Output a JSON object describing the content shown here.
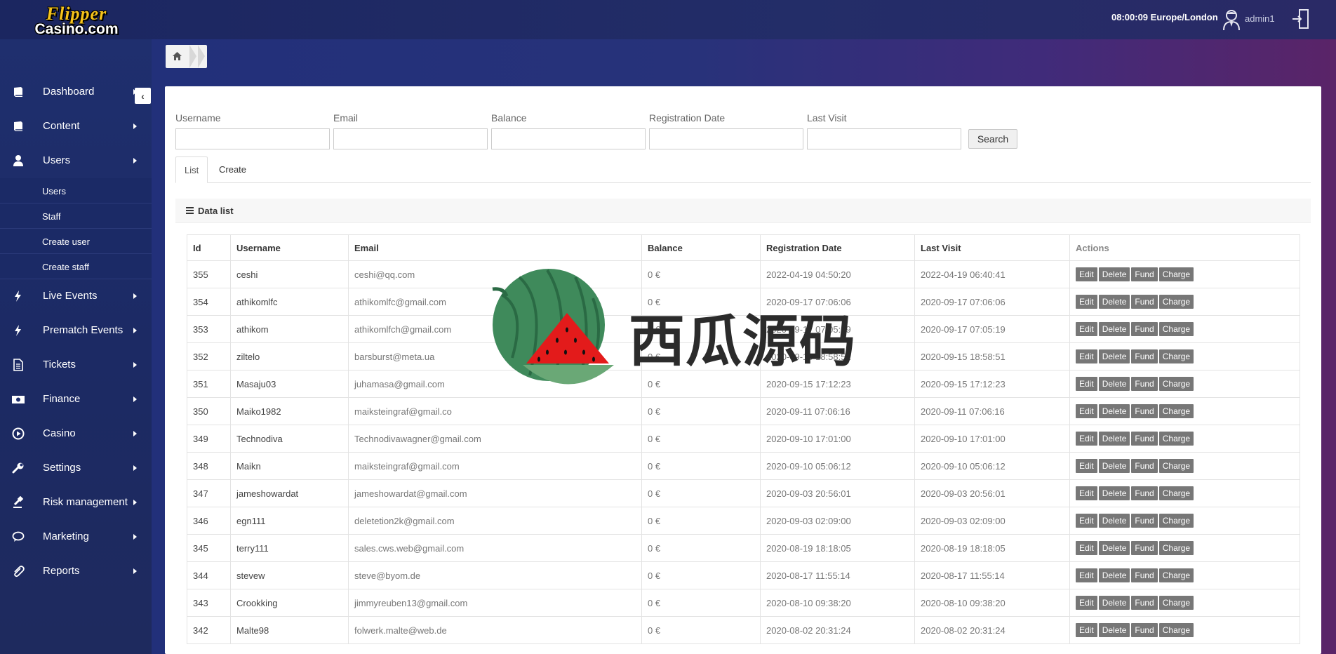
{
  "app": {
    "logo_line1": "Flipper",
    "logo_line2": "Casino.com"
  },
  "header": {
    "clock": "08:00:09 Europe/London",
    "username": "admin1"
  },
  "sidebar": {
    "items": [
      {
        "label": "Dashboard",
        "icon": "book-icon"
      },
      {
        "label": "Content",
        "icon": "book-icon"
      },
      {
        "label": "Users",
        "icon": "user-icon"
      },
      {
        "label": "Live Events",
        "icon": "bolt-icon"
      },
      {
        "label": "Prematch Events",
        "icon": "bolt-icon"
      },
      {
        "label": "Tickets",
        "icon": "document-icon"
      },
      {
        "label": "Finance",
        "icon": "money-icon"
      },
      {
        "label": "Casino",
        "icon": "play-circle-icon"
      },
      {
        "label": "Settings",
        "icon": "wrench-icon"
      },
      {
        "label": "Risk management",
        "icon": "gavel-icon"
      },
      {
        "label": "Marketing",
        "icon": "chat-icon"
      },
      {
        "label": "Reports",
        "icon": "paperclip-icon"
      }
    ],
    "users_submenu": [
      "Users",
      "Staff",
      "Create user",
      "Create staff"
    ]
  },
  "filters": {
    "username_label": "Username",
    "email_label": "Email",
    "balance_label": "Balance",
    "registration_label": "Registration Date",
    "last_visit_label": "Last Visit",
    "username_value": "",
    "email_value": "",
    "balance_value": "",
    "registration_value": "",
    "last_visit_value": "",
    "search_label": "Search"
  },
  "tabs": {
    "list": "List",
    "create": "Create"
  },
  "datalist": {
    "title": "Data list"
  },
  "table": {
    "columns": [
      "Id",
      "Username",
      "Email",
      "Balance",
      "Registration Date",
      "Last Visit",
      "Actions"
    ],
    "actions": [
      "Edit",
      "Delete",
      "Fund",
      "Charge"
    ],
    "rows": [
      {
        "id": "355",
        "username": "ceshi",
        "email": "ceshi@qq.com",
        "balance": "0 €",
        "registered": "2022-04-19 04:50:20",
        "last_visit": "2022-04-19 06:40:41"
      },
      {
        "id": "354",
        "username": "athikomlfc",
        "email": "athikomlfc@gmail.com",
        "balance": "0 €",
        "registered": "2020-09-17 07:06:06",
        "last_visit": "2020-09-17 07:06:06"
      },
      {
        "id": "353",
        "username": "athikom",
        "email": "athikomlfch@gmail.com",
        "balance": "0 €",
        "registered": "2020-09-17 07:05:19",
        "last_visit": "2020-09-17 07:05:19"
      },
      {
        "id": "352",
        "username": "ziltelo",
        "email": "barsburst@meta.ua",
        "balance": "0 €",
        "registered": "2020-09-15 18:58:51",
        "last_visit": "2020-09-15 18:58:51"
      },
      {
        "id": "351",
        "username": "Masaju03",
        "email": "juhamasa@gmail.com",
        "balance": "0 €",
        "registered": "2020-09-15 17:12:23",
        "last_visit": "2020-09-15 17:12:23"
      },
      {
        "id": "350",
        "username": "Maiko1982",
        "email": "maiksteingraf@gmail.co",
        "balance": "0 €",
        "registered": "2020-09-11 07:06:16",
        "last_visit": "2020-09-11 07:06:16"
      },
      {
        "id": "349",
        "username": "Technodiva",
        "email": "Technodivawagner@gmail.com",
        "balance": "0 €",
        "registered": "2020-09-10 17:01:00",
        "last_visit": "2020-09-10 17:01:00"
      },
      {
        "id": "348",
        "username": "Maikn",
        "email": "maiksteingraf@gmail.com",
        "balance": "0 €",
        "registered": "2020-09-10 05:06:12",
        "last_visit": "2020-09-10 05:06:12"
      },
      {
        "id": "347",
        "username": "jameshowardat",
        "email": "jameshowardat@gmail.com",
        "balance": "0 €",
        "registered": "2020-09-03 20:56:01",
        "last_visit": "2020-09-03 20:56:01"
      },
      {
        "id": "346",
        "username": "egn111",
        "email": "deletetion2k@gmail.com",
        "balance": "0 €",
        "registered": "2020-09-03 02:09:00",
        "last_visit": "2020-09-03 02:09:00"
      },
      {
        "id": "345",
        "username": "terry111",
        "email": "sales.cws.web@gmail.com",
        "balance": "0 €",
        "registered": "2020-08-19 18:18:05",
        "last_visit": "2020-08-19 18:18:05"
      },
      {
        "id": "344",
        "username": "stevew",
        "email": "steve@byom.de",
        "balance": "0 €",
        "registered": "2020-08-17 11:55:14",
        "last_visit": "2020-08-17 11:55:14"
      },
      {
        "id": "343",
        "username": "Crookking",
        "email": "jimmyreuben13@gmail.com",
        "balance": "0 €",
        "registered": "2020-08-10 09:38:20",
        "last_visit": "2020-08-10 09:38:20"
      },
      {
        "id": "342",
        "username": "Malte98",
        "email": "folwerk.malte@web.de",
        "balance": "0 €",
        "registered": "2020-08-02 20:31:24",
        "last_visit": "2020-08-02 20:31:24"
      }
    ]
  },
  "watermark": {
    "text": "西瓜源码"
  },
  "colors": {
    "sidebar_bg": "#1f2f6e",
    "topbar_bg": "#1b2660",
    "action_button": "#777777",
    "logo_yellow": "#f6c31b"
  }
}
